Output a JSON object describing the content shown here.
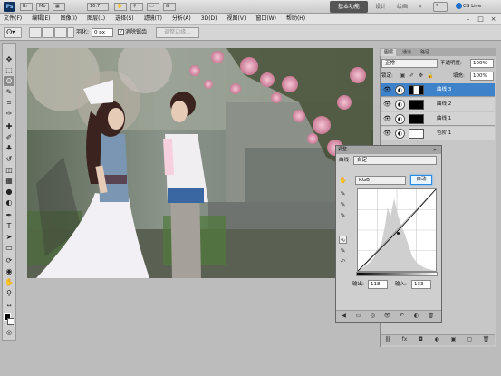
{
  "titlebar": {
    "logo": "Ps",
    "zoom": "16.7",
    "workspaces": [
      "基本功能",
      "设计",
      "绘画"
    ],
    "active_workspace": "基本功能",
    "more": "»",
    "cs_live": "CS Live"
  },
  "menu": {
    "items": [
      "文件(F)",
      "编辑(E)",
      "图像(I)",
      "图层(L)",
      "选择(S)",
      "滤镜(T)",
      "分析(A)",
      "3D(D)",
      "视图(V)",
      "窗口(W)",
      "帮助(H)"
    ],
    "minimize": "–",
    "restore": "□",
    "close": "×"
  },
  "options": {
    "feather_label": "羽化:",
    "feather_value": "0 px",
    "antialias_check": "✓",
    "antialias_label": "消除锯齿",
    "refine_edge": "调整边缘..."
  },
  "tools": {
    "move": "✥",
    "marquee": "⬚",
    "lasso": "ʘ",
    "quick": "✎",
    "crop": "⌗",
    "eyedropper": "✑",
    "heal": "✚",
    "brush": "✐",
    "stamp": "♣",
    "history": "↺",
    "eraser": "◫",
    "gradient": "▦",
    "blur": "●",
    "dodge": "◐",
    "pen": "✒",
    "type": "T",
    "path": "➤",
    "shape": "▭",
    "3d_rotate": "⟳",
    "3d_camera": "◉",
    "hand": "✋",
    "zoom": "⚲",
    "swap": "↔",
    "mask": "◎"
  },
  "layers": {
    "tabs": [
      "图层",
      "通道",
      "路径"
    ],
    "blend_mode": "正常",
    "opacity_label": "不透明度:",
    "opacity_value": "100%",
    "lock_label": "锁定:",
    "fill_label": "填充:",
    "fill_value": "100%",
    "eye": "👁",
    "adj_glyph": "◐",
    "rows": [
      {
        "name": "曲线 3"
      },
      {
        "name": "曲线 2"
      },
      {
        "name": "曲线 1"
      },
      {
        "name": "色阶 1"
      }
    ],
    "footer_icons": [
      "⛓",
      "fx",
      "◘",
      "◐",
      "▣",
      "▢",
      "🗑"
    ]
  },
  "adjustments": {
    "tab": "调整",
    "close": "»",
    "curves_label": "曲线",
    "preset": "自定",
    "channel": "RGB",
    "auto_button": "自动",
    "output_label": "输出:",
    "output_value": "118",
    "input_label": "输入:",
    "input_value": "133",
    "side_icons": [
      "✋",
      "✎",
      "✎",
      "✎",
      "∿",
      "✎",
      "↶"
    ],
    "footer_icons": [
      "◀",
      "▭",
      "◎",
      "👁",
      "↶",
      "◐",
      "🗑"
    ]
  },
  "colors": {
    "accent_blue": "#3e82c9",
    "auto_button_border": "#2b8be2"
  }
}
